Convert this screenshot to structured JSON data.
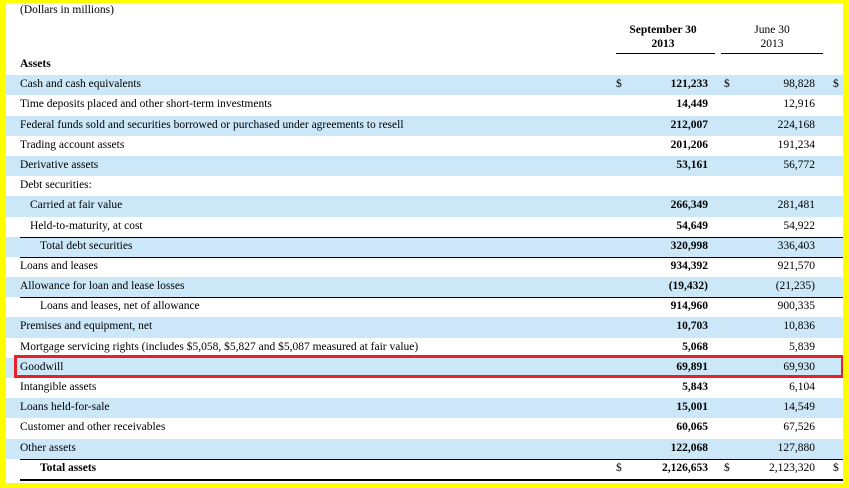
{
  "caption": "(Dollars in millions)",
  "columns": {
    "current": {
      "line1": "September 30",
      "line2": "2013"
    },
    "prior": {
      "line1": "June 30",
      "line2": "2013"
    }
  },
  "section_title": "Assets",
  "colors": {
    "highlight_border": "#e8202a",
    "row_shade": "#cce8f8",
    "frame": "#ffff00"
  },
  "rows": [
    {
      "label": "Cash and cash equivalents",
      "cur": "121,233",
      "prior": "98,828",
      "dollar": true
    },
    {
      "label": "Time deposits placed and other short-term investments",
      "cur": "14,449",
      "prior": "12,916"
    },
    {
      "label": "Federal funds sold and securities borrowed or purchased under agreements to resell",
      "cur": "212,007",
      "prior": "224,168"
    },
    {
      "label": "Trading account assets",
      "cur": "201,206",
      "prior": "191,234"
    },
    {
      "label": "Derivative assets",
      "cur": "53,161",
      "prior": "56,772"
    },
    {
      "label": "Debt securities:",
      "cur": "",
      "prior": ""
    },
    {
      "label": "Carried at fair value",
      "cur": "266,349",
      "prior": "281,481"
    },
    {
      "label": "Held-to-maturity, at cost",
      "cur": "54,649",
      "prior": "54,922"
    },
    {
      "label": "Total debt securities",
      "cur": "320,998",
      "prior": "336,403"
    },
    {
      "label": "Loans and leases",
      "cur": "934,392",
      "prior": "921,570"
    },
    {
      "label": "Allowance for loan and lease losses",
      "cur": "(19,432)",
      "prior": "(21,235)"
    },
    {
      "label": "Loans and leases, net of allowance",
      "cur": "914,960",
      "prior": "900,335"
    },
    {
      "label": "Premises and equipment, net",
      "cur": "10,703",
      "prior": "10,836"
    },
    {
      "label": "Mortgage servicing rights (includes $5,058, $5,827 and $5,087 measured at fair value)",
      "cur": "5,068",
      "prior": "5,839"
    },
    {
      "label": "Goodwill",
      "cur": "69,891",
      "prior": "69,930"
    },
    {
      "label": "Intangible assets",
      "cur": "5,843",
      "prior": "6,104"
    },
    {
      "label": "Loans held-for-sale",
      "cur": "15,001",
      "prior": "14,549"
    },
    {
      "label": "Customer and other receivables",
      "cur": "60,065",
      "prior": "67,526"
    },
    {
      "label": "Other assets",
      "cur": "122,068",
      "prior": "127,880"
    },
    {
      "label": "Total assets",
      "cur": "2,126,653",
      "prior": "2,123,320",
      "dollar": true
    }
  ],
  "dollar_sign": "$"
}
